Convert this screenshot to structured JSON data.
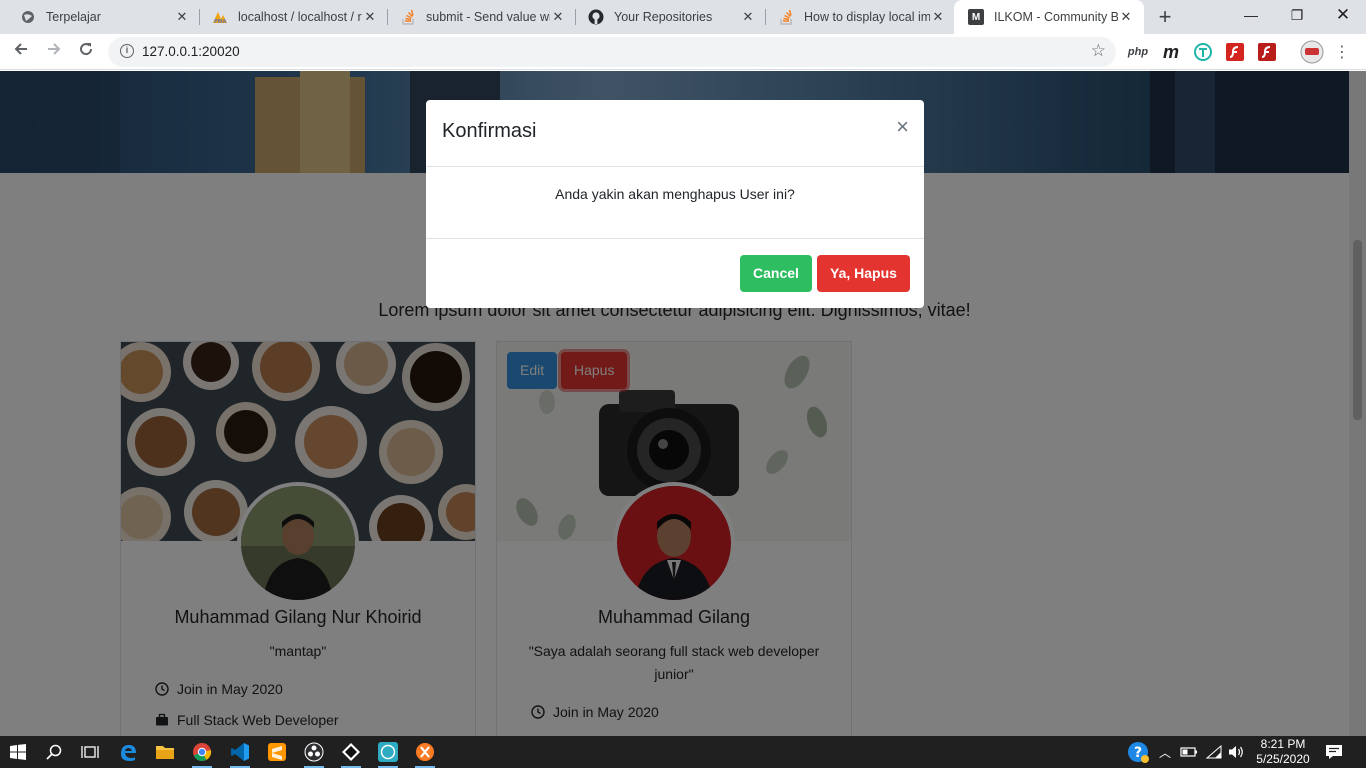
{
  "browser": {
    "tabs": [
      {
        "title": "Terpelajar",
        "icon": "globe-icon",
        "active": false
      },
      {
        "title": "localhost / localhost / r",
        "icon": "phpmyadmin-icon",
        "active": false
      },
      {
        "title": "submit - Send value wit",
        "icon": "stackoverflow-icon",
        "active": false
      },
      {
        "title": "Your Repositories",
        "icon": "github-icon",
        "active": false
      },
      {
        "title": "How to display local im",
        "icon": "stackoverflow-icon",
        "active": false
      },
      {
        "title": "ILKOM - Community Bl",
        "icon": "m-logo-icon",
        "active": true
      }
    ],
    "favicon_letter": "M",
    "url": "127.0.0.1:20020",
    "extensions": [
      "php",
      "m"
    ]
  },
  "page": {
    "lead": "Lorem ipsum dolor sit amet consectetur adipisicing elit. Dignissimos, vitae!",
    "cards": [
      {
        "name": "Muhammad Gilang Nur Khoirid",
        "quote": "\"mantap\"",
        "join": "Join in May 2020",
        "role": "Full Stack Web Developer"
      },
      {
        "name": "Muhammad Gilang",
        "quote": "\"Saya adalah seorang full stack web developer junior\"",
        "join": "Join in May 2020",
        "edit_label": "Edit",
        "delete_label": "Hapus"
      }
    ]
  },
  "modal": {
    "title": "Konfirmasi",
    "close": "×",
    "message": "Anda yakin akan menghapus User ini?",
    "cancel_label": "Cancel",
    "confirm_label": "Ya, Hapus"
  },
  "taskbar": {
    "time": "8:21 PM",
    "date": "5/25/2020"
  },
  "colors": {
    "success": "#2ebd60",
    "danger": "#e3342f",
    "primary": "#3490dc"
  }
}
